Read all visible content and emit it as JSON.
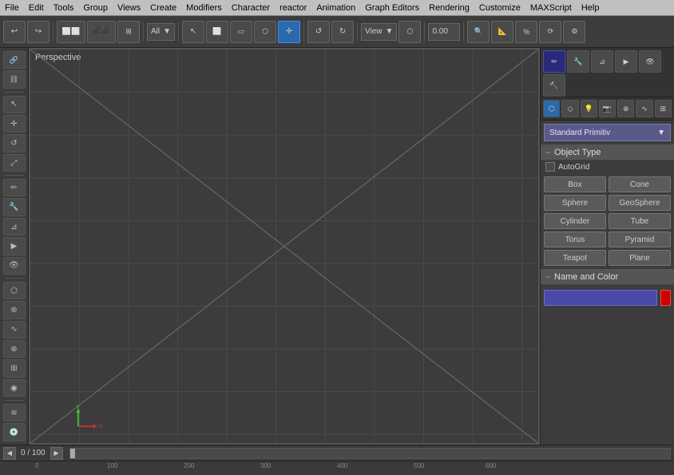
{
  "menu": {
    "items": [
      "File",
      "Edit",
      "Tools",
      "Group",
      "Views",
      "Create",
      "Modifiers",
      "Character",
      "reactor",
      "Animation",
      "Graph Editors",
      "Rendering",
      "Customize",
      "MAXScript",
      "Help"
    ]
  },
  "toolbar": {
    "filter_label": "All",
    "view_label": "View",
    "coord_value": "0.00"
  },
  "viewport": {
    "label": "Perspective"
  },
  "right_panel": {
    "dropdown_label": "Standard Primitiv",
    "object_type_header": "Object Type",
    "autogrid_label": "AutoGrid",
    "buttons": [
      {
        "label": "Box"
      },
      {
        "label": "Cone"
      },
      {
        "label": "Sphere"
      },
      {
        "label": "GeoSphere"
      },
      {
        "label": "Cylinder"
      },
      {
        "label": "Tube"
      },
      {
        "label": "Torus"
      },
      {
        "label": "Pyramid"
      },
      {
        "label": "Teapot"
      },
      {
        "label": "Plane"
      }
    ],
    "name_color_header": "Name and Color",
    "name_value": ""
  },
  "timeline": {
    "frame_current": "0",
    "frame_total": "100"
  },
  "ruler": {
    "ticks": [
      "0",
      "100",
      "200",
      "300",
      "400",
      "500",
      "600"
    ]
  },
  "icons": {
    "undo": "↩",
    "redo": "↪",
    "select": "↖",
    "move": "✛",
    "rotate": "↺",
    "scale": "⤢",
    "link": "🔗",
    "unlink": "⛓",
    "dropdown_arrow": "▼",
    "minus": "−",
    "checkbox_empty": ""
  }
}
